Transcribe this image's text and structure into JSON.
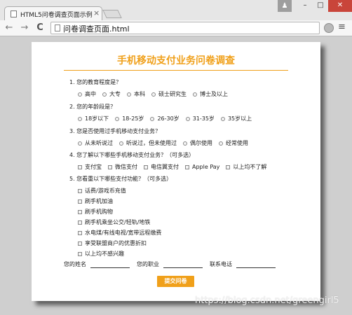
{
  "browser": {
    "tab_title": "HTML5问卷调查页面示例",
    "tab_close": "×",
    "url": "问卷调查页面.html",
    "nav_back": "←",
    "nav_forward": "→",
    "nav_reload": "C",
    "menu": "≡",
    "win_user": "♟",
    "win_minimize": "–",
    "win_maximize": "□",
    "win_close": "✕"
  },
  "survey": {
    "title": "手机移动支付业务问卷调查",
    "accent_color": "#f0a01a",
    "questions": [
      {
        "label": "1. 您的教育程度是？",
        "type": "radio",
        "options": [
          "高中",
          "大专",
          "本科",
          "硕士研究生",
          "博士及以上"
        ]
      },
      {
        "label": "2. 您的年龄段是？",
        "type": "radio",
        "options": [
          "18岁以下",
          "18-25岁",
          "26-30岁",
          "31-35岁",
          "35岁以上"
        ]
      },
      {
        "label": "3. 您是否使用过手机移动支付业务？",
        "type": "radio",
        "options": [
          "从未听说过",
          "听说过，但未使用过",
          "偶尔使用",
          "经常使用"
        ]
      },
      {
        "label": "4. 您了解以下哪些手机移动支付业务？（可多选）",
        "type": "checkbox",
        "options": [
          "支付宝",
          "微信支付",
          "电信翼支付",
          "Apple Pay",
          "以上均不了解"
        ]
      },
      {
        "label": "5. 您看重以下哪些支付功能？（可多选）",
        "type": "checkbox",
        "options": [
          "话费/游戏币充值",
          "刷手机加油",
          "刷手机购物",
          "刷手机乘坐公交/轻轨/地铁",
          "水电煤/有线电视/宽带远程缴费",
          "享受联盟商户的优惠折扣",
          "以上均不感兴趣"
        ]
      }
    ],
    "fields": {
      "name_label": "您的姓名",
      "job_label": "您的职业",
      "phone_label": "联系电话"
    },
    "submit_label": "提交问卷"
  },
  "watermark": "https://blog.csdn.net/greengirl5"
}
